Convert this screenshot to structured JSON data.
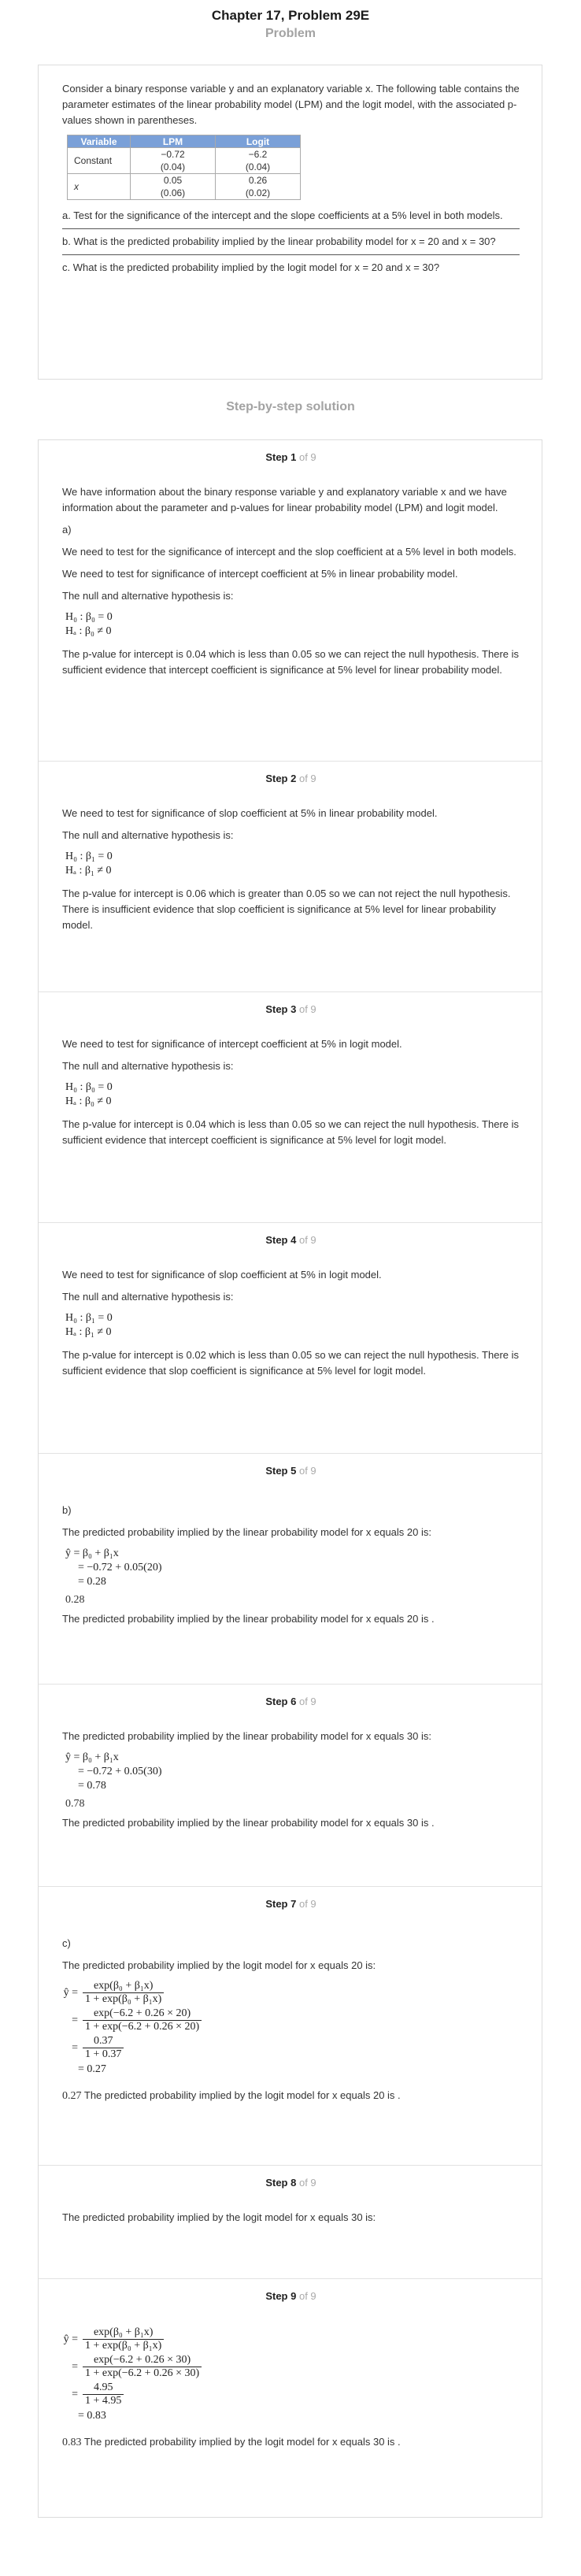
{
  "header": {
    "title": "Chapter 17, Problem 29E",
    "problem_label": "Problem",
    "solution_label": "Step-by-step solution"
  },
  "problem": {
    "intro": "Consider a binary response variable y and an explanatory variable x. The following table contains the parameter estimates of the linear probability model (LPM) and the logit model, with the associated p-values shown in parentheses.",
    "table": {
      "headers": [
        "Variable",
        "LPM",
        "Logit"
      ],
      "rows": [
        {
          "label": "Constant",
          "lpm": "−0.72",
          "lpm_p": "(0.04)",
          "logit": "−6.2",
          "logit_p": "(0.04)"
        },
        {
          "label": "x",
          "lpm": "0.05",
          "lpm_p": "(0.06)",
          "logit": "0.26",
          "logit_p": "(0.02)"
        }
      ]
    },
    "part_a": "a. Test for the significance of the intercept and the slope coefficients at a 5% level in both models.",
    "part_b": "b. What is the predicted probability implied by the linear probability model for x = 20 and x = 30?",
    "part_c": "c. What is the predicted probability implied by the logit model for x = 20 and x = 30?"
  },
  "steps": {
    "of_label": "of 9",
    "s1": {
      "label": "Step 1",
      "intro": "We have information about the binary response variable y and explanatory variable x and we have information about the parameter and p-values for linear probability model (LPM) and logit model.",
      "part": "a)",
      "p1": "We need to test for the significance of intercept and the slop coefficient at a 5% level in both models.",
      "p2": "We need to test for significance of intercept coefficient at 5% in linear probability model.",
      "p3": "The null and alternative hypothesis is:",
      "h0": "H₀ : β₀ = 0",
      "ha": "Hₐ : β₀ ≠ 0",
      "p4": "The p-value for intercept is 0.04 which is less than 0.05 so we can reject the null hypothesis. There is sufficient evidence that intercept coefficient is significance at 5% level for linear probability model."
    },
    "s2": {
      "label": "Step 2",
      "p1": "We need to test for significance of slop coefficient at 5% in linear probability model.",
      "p2": "The null and alternative hypothesis is:",
      "h0": "H₀ : β₁ = 0",
      "ha": "Hₐ : β₁ ≠ 0",
      "p3": "The p-value for intercept is 0.06 which is greater than 0.05 so we can not reject the null hypothesis. There is insufficient evidence that slop coefficient is significance at 5% level for linear probability model."
    },
    "s3": {
      "label": "Step 3",
      "p1": "We need to test for significance of intercept coefficient at 5% in logit model.",
      "p2": "The null and alternative hypothesis is:",
      "h0": "H₀ : β₀ = 0",
      "ha": "Hₐ : β₀ ≠ 0",
      "p3": "The p-value for intercept is 0.04 which is less than 0.05 so we can reject the null hypothesis. There is sufficient evidence that intercept coefficient is significance at 5% level for logit model."
    },
    "s4": {
      "label": "Step 4",
      "p1": "We need to test for significance of slop coefficient at 5% in logit model.",
      "p2": "The null and alternative hypothesis is:",
      "h0": "H₀ : β₁ = 0",
      "ha": "Hₐ : β₁ ≠ 0",
      "p3": "The p-value for intercept is 0.02 which is less than 0.05 so we can reject the null hypothesis. There is sufficient evidence that slop coefficient is significance at 5% level for logit model."
    },
    "s5": {
      "label": "Step 5",
      "part": "b)",
      "p1": "The predicted probability implied by the linear probability model for x equals 20 is:",
      "eq1": "ŷ = β₀ + β₁x",
      "eq2": "= −0.72 + 0.05(20)",
      "eq3": "= 0.28",
      "final": "0.28",
      "p2": "The predicted probability implied by the linear probability model for x equals 20 is ."
    },
    "s6": {
      "label": "Step 6",
      "p1": "The predicted probability implied by the linear probability model for x equals 30 is:",
      "eq1": "ŷ = β₀ + β₁x",
      "eq2": "= −0.72 + 0.05(30)",
      "eq3": "= 0.78",
      "final": "0.78",
      "p2": "The predicted probability implied by the linear probability model for x equals 30 is ."
    },
    "s7": {
      "label": "Step 7",
      "part": "c)",
      "p1": "The predicted probability implied by the logit model for x equals 20 is:",
      "f1_num": "exp(β₀ + β₁x)",
      "f1_den": "1 + exp(β₀ + β₁x)",
      "f2_num": "exp(−6.2 + 0.26 × 20)",
      "f2_den": "1 + exp(−6.2 + 0.26 × 20)",
      "f3_num": "0.37",
      "f3_den": "1 + 0.37",
      "eq_last": "= 0.27",
      "final": "0.27",
      "p2": "The predicted probability implied by the logit model for x equals 20 is ."
    },
    "s8": {
      "label": "Step 8",
      "p1": "The predicted probability implied by the logit model for x equals 30 is:"
    },
    "s9": {
      "label": "Step 9",
      "f1_num": "exp(β₀ + β₁x)",
      "f1_den": "1 + exp(β₀ + β₁x)",
      "f2_num": "exp(−6.2 + 0.26 × 30)",
      "f2_den": "1 + exp(−6.2 + 0.26 × 30)",
      "f3_num": "4.95",
      "f3_den": "1 + 4.95",
      "eq_last": "= 0.83",
      "final": "0.83",
      "p2": "The predicted probability implied by the logit model for x equals 30 is ."
    }
  }
}
